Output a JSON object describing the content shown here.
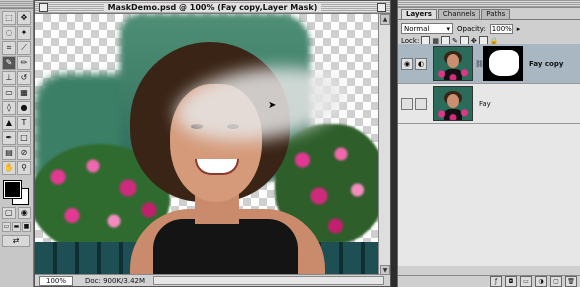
{
  "toolbox": {
    "tools": [
      {
        "name": "marquee-tool-icon",
        "glyph": "⬚"
      },
      {
        "name": "move-tool-icon",
        "glyph": "✥"
      },
      {
        "name": "lasso-tool-icon",
        "glyph": "◌"
      },
      {
        "name": "magic-wand-tool-icon",
        "glyph": "✦"
      },
      {
        "name": "crop-tool-icon",
        "glyph": "⌗"
      },
      {
        "name": "slice-tool-icon",
        "glyph": "⟋"
      },
      {
        "name": "paintbrush-tool-icon",
        "glyph": "✎"
      },
      {
        "name": "pencil-tool-icon",
        "glyph": "✏"
      },
      {
        "name": "stamp-tool-icon",
        "glyph": "⊥"
      },
      {
        "name": "history-brush-tool-icon",
        "glyph": "↺"
      },
      {
        "name": "eraser-tool-icon",
        "glyph": "▭"
      },
      {
        "name": "gradient-tool-icon",
        "glyph": "▦"
      },
      {
        "name": "blur-tool-icon",
        "glyph": "◊"
      },
      {
        "name": "dodge-tool-icon",
        "glyph": "●"
      },
      {
        "name": "path-selection-tool-icon",
        "glyph": "▲"
      },
      {
        "name": "type-tool-icon",
        "glyph": "T"
      },
      {
        "name": "pen-tool-icon",
        "glyph": "✒"
      },
      {
        "name": "shape-tool-icon",
        "glyph": "□"
      },
      {
        "name": "notes-tool-icon",
        "glyph": "▤"
      },
      {
        "name": "eyedropper-tool-icon",
        "glyph": "⊘"
      },
      {
        "name": "hand-tool-icon",
        "glyph": "✋"
      },
      {
        "name": "zoom-tool-icon",
        "glyph": "⚲"
      }
    ]
  },
  "document": {
    "title": "MaskDemo.psd @ 100% (Fay copy,Layer Mask)",
    "zoom": "100%",
    "doc_info": "Doc: 900K/3.42M"
  },
  "layers_palette": {
    "tabs": [
      "Layers",
      "Channels",
      "Paths"
    ],
    "active_tab": "Layers",
    "blend_mode": "Normal",
    "opacity_label": "Opacity:",
    "opacity_value": "100%",
    "lock_label": "Lock:",
    "layers": [
      {
        "name": "Fay copy",
        "visible": true,
        "has_mask": true,
        "selected": true
      },
      {
        "name": "Fay",
        "visible": false,
        "has_mask": false,
        "selected": false
      }
    ]
  },
  "colors": {
    "layer_selected_bg": "#a8b7c2",
    "foreground": "#000000",
    "background": "#ffffff"
  }
}
